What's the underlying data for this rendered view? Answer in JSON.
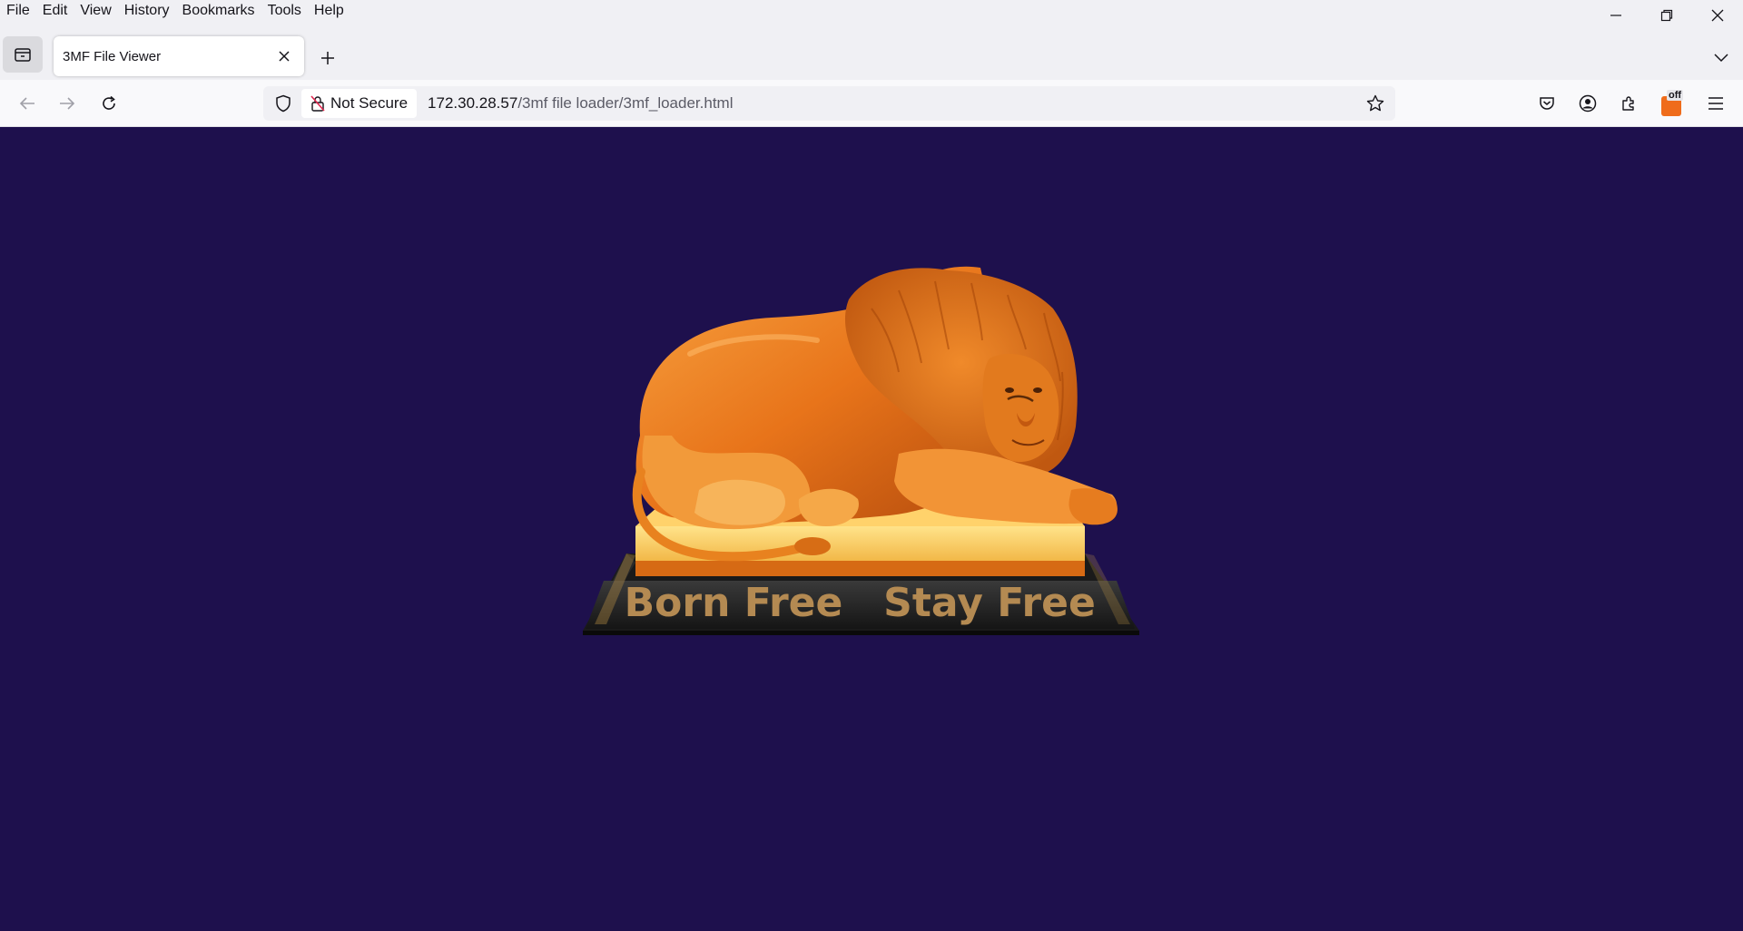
{
  "menubar": {
    "items": [
      "File",
      "Edit",
      "View",
      "History",
      "Bookmarks",
      "Tools",
      "Help"
    ]
  },
  "tabs": [
    {
      "title": "3MF File Viewer",
      "active": true
    }
  ],
  "navbar": {
    "security_label": "Not Secure",
    "url_host": "172.30.28.57",
    "url_path": "/3mf file loader/3mf_loader.html",
    "extension_badge": "off"
  },
  "viewer": {
    "background_color": "#1e104d",
    "model_color": "#e8741a",
    "base_text_left": "Born Free",
    "base_text_right": "Stay Free"
  },
  "icons": [
    "tab-overview-icon",
    "close-icon",
    "plus-icon",
    "chevron-down-icon",
    "back-icon",
    "forward-icon",
    "reload-icon",
    "shield-icon",
    "not-secure-lock-icon",
    "star-icon",
    "pocket-icon",
    "account-icon",
    "extensions-icon",
    "menu-icon",
    "minimize-icon",
    "restore-icon"
  ]
}
